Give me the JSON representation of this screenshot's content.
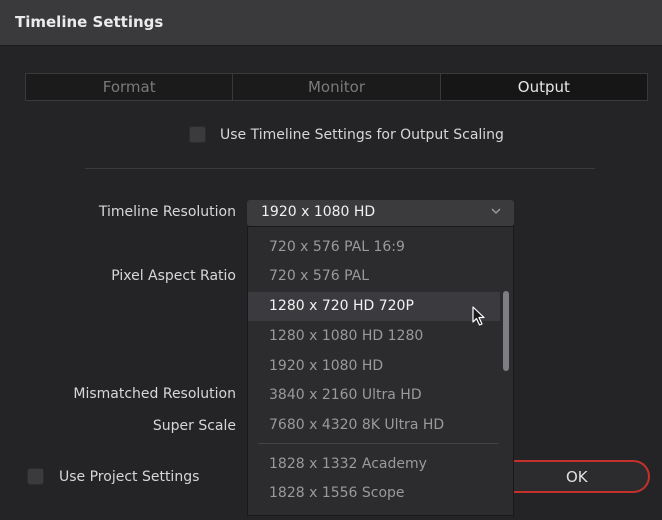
{
  "window": {
    "title": "Timeline Settings"
  },
  "tabs": [
    {
      "label": "Format",
      "active": false
    },
    {
      "label": "Monitor",
      "active": false
    },
    {
      "label": "Output",
      "active": true
    }
  ],
  "output_scaling": {
    "label": "Use Timeline Settings for Output Scaling",
    "checked": false
  },
  "fields": {
    "timeline_resolution": "Timeline Resolution",
    "pixel_aspect_ratio": "Pixel Aspect Ratio",
    "mismatched_resolution": "Mismatched Resolution",
    "super_scale": "Super Scale"
  },
  "resolution_select": {
    "value": "1920 x 1080 HD",
    "options": [
      "720 x 576 PAL 16:9",
      "720 x 576 PAL",
      "1280 x 720 HD 720P",
      "1280 x 1080 HD 1280",
      "1920 x 1080 HD",
      "3840 x 2160 Ultra HD",
      "7680 x 4320 8K Ultra HD",
      "1828 x 1332 Academy",
      "1828 x 1556 Scope"
    ],
    "highlighted": "1280 x 720 HD 720P"
  },
  "project_settings": {
    "label": "Use Project Settings",
    "checked": false
  },
  "buttons": {
    "ok": "OK"
  },
  "colors": {
    "ok_border": "#c4312b",
    "background": "#242426",
    "highlight": "#3b3b3f"
  },
  "icons": {
    "dropdown": "chevron-down-icon",
    "cursor": "mouse-pointer-icon"
  }
}
